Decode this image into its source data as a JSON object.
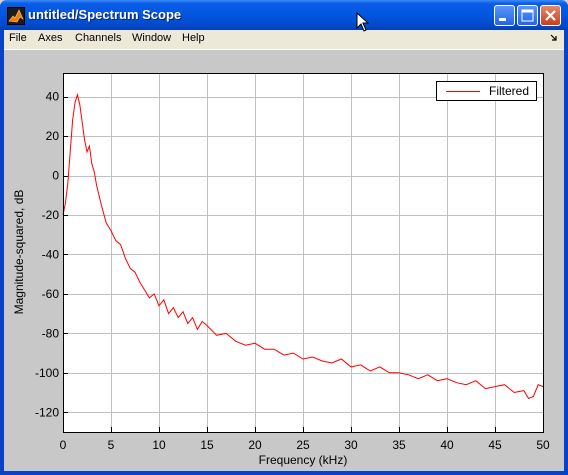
{
  "window": {
    "title": "untitled/Spectrum Scope"
  },
  "menu": {
    "items": [
      "File",
      "Axes",
      "Channels",
      "Window",
      "Help"
    ]
  },
  "colors": {
    "series": "#ff0000",
    "title_bar": "#0356e0"
  },
  "chart_data": {
    "type": "line",
    "title": "",
    "xlabel": "Frequency (kHz)",
    "ylabel": "Magnitude-squared, dB",
    "xlim": [
      0,
      50
    ],
    "ylim": [
      -130,
      52
    ],
    "xticks": [
      0,
      5,
      10,
      15,
      20,
      25,
      30,
      35,
      40,
      45,
      50
    ],
    "yticks": [
      -120,
      -100,
      -80,
      -60,
      -40,
      -20,
      0,
      20,
      40
    ],
    "grid": true,
    "legend": "top-right",
    "series": [
      {
        "name": "Filtered",
        "color": "#ff0000",
        "x": [
          0,
          0.25,
          0.5,
          0.75,
          1.0,
          1.25,
          1.5,
          1.75,
          2.0,
          2.25,
          2.5,
          2.75,
          3.0,
          3.25,
          3.5,
          3.75,
          4.0,
          4.5,
          5.0,
          5.5,
          6.0,
          6.5,
          7.0,
          7.5,
          8.0,
          8.5,
          9.0,
          9.5,
          10,
          10.5,
          11,
          11.5,
          12,
          12.5,
          13,
          13.5,
          14,
          14.5,
          15,
          16,
          17,
          18,
          19,
          20,
          21,
          22,
          23,
          24,
          25,
          26,
          27,
          28,
          29,
          30,
          31,
          32,
          33,
          34,
          35,
          36,
          37,
          38,
          39,
          40,
          41,
          42,
          43,
          44,
          45,
          46,
          47,
          48,
          48.5,
          49,
          49.5,
          50
        ],
        "y": [
          -20,
          -14,
          -4,
          12,
          28,
          37,
          41,
          36,
          27,
          18,
          12,
          15,
          6,
          2,
          -5,
          -10,
          -15,
          -24,
          -28,
          -33,
          -35,
          -42,
          -47,
          -49,
          -54,
          -58,
          -62,
          -60,
          -66,
          -63,
          -70,
          -67,
          -72,
          -69,
          -75,
          -72,
          -78,
          -74,
          -76,
          -81,
          -80,
          -84,
          -86,
          -85,
          -88,
          -88,
          -91,
          -90,
          -93,
          -92,
          -94,
          -95,
          -93,
          -97,
          -96,
          -99,
          -97,
          -100,
          -100,
          -101,
          -103,
          -101,
          -104,
          -103,
          -105,
          -106,
          -104,
          -108,
          -107,
          -106,
          -110,
          -109,
          -113,
          -112,
          -106,
          -107
        ]
      }
    ]
  }
}
